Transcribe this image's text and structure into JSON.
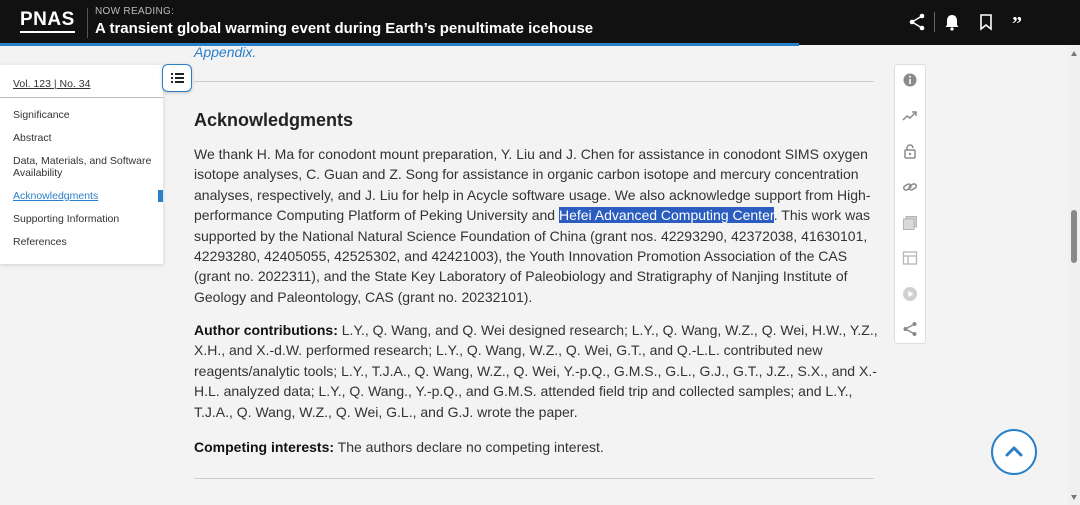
{
  "header": {
    "logo": "PNAS",
    "now_reading_label": "NOW READING:",
    "article_title": "A transient global warming event during Earth’s penultimate icehouse",
    "reading_progress_percent": 74,
    "icons": [
      "share-icon",
      "bell-icon",
      "bookmark-icon",
      "quote-icon"
    ]
  },
  "toc": {
    "volume": "Vol. 123 | No. 34",
    "items": [
      {
        "label": "Significance"
      },
      {
        "label": "Abstract"
      },
      {
        "label": "Data, Materials, and Software Availability"
      },
      {
        "label": "Acknowledgments",
        "active": true
      },
      {
        "label": "Supporting Information"
      },
      {
        "label": "References"
      }
    ],
    "toggle_icon": "list-icon"
  },
  "article": {
    "appendix_fragment": "Appendix.",
    "heading": "Acknowledgments",
    "ack_part1": "We thank H. Ma for conodont mount preparation, Y. Liu and J. Chen for assistance in conodont SIMS oxygen isotope analyses, C. Guan and Z. Song for assistance in organic carbon isotope and mercury concentration analyses, respectively, and J. Liu for help in Acycle software usage. We also acknowledge support from High-performance Computing Platform of Peking University and ",
    "ack_highlight": "Hefei Advanced Computing Center",
    "ack_part2": ". This work was supported by the National Natural Science Foundation of China (grant nos. 42293290, 42372038, 41630101, 42293280, 42405055, 42525302, and 42421003), the Youth Innovation Promotion Association of the CAS (grant no. 2022311), and the State Key Laboratory of Paleobiology and Stratigraphy of Nanjing Institute of Geology and Paleontology, CAS (grant no. 20232101).",
    "contrib_label": "Author contributions:",
    "contrib_text": " L.Y., Q. Wang, and Q. Wei designed research; L.Y., Q. Wang, W.Z., Q. Wei, H.W., Y.Z., X.H., and X.-d.W. performed research; L.Y., Q. Wang, W.Z., Q. Wei, G.T., and Q.-L.L. contributed new reagents/analytic tools; L.Y., T.J.A., Q. Wang, W.Z., Q. Wei, Y.-p.Q., G.M.S., G.L., G.J., G.T., J.Z., S.X., and X.-H.L. analyzed data; L.Y., Q. Wang., Y.-p.Q., and G.M.S. attended field trip and collected samples; and L.Y., T.J.A., Q. Wang, W.Z., Q. Wei, G.L., and G.J. wrote the paper.",
    "competing_label": "Competing interests:",
    "competing_text": " The authors declare no competing interest."
  },
  "side_tools": [
    "info-icon",
    "metrics-icon",
    "access-lock-icon",
    "link-icon",
    "figures-icon",
    "tables-icon",
    "media-icon",
    "share-icon"
  ],
  "colors": {
    "accent": "#2a7fc9",
    "topbar": "#111111",
    "highlight": "#2a5dbf"
  }
}
